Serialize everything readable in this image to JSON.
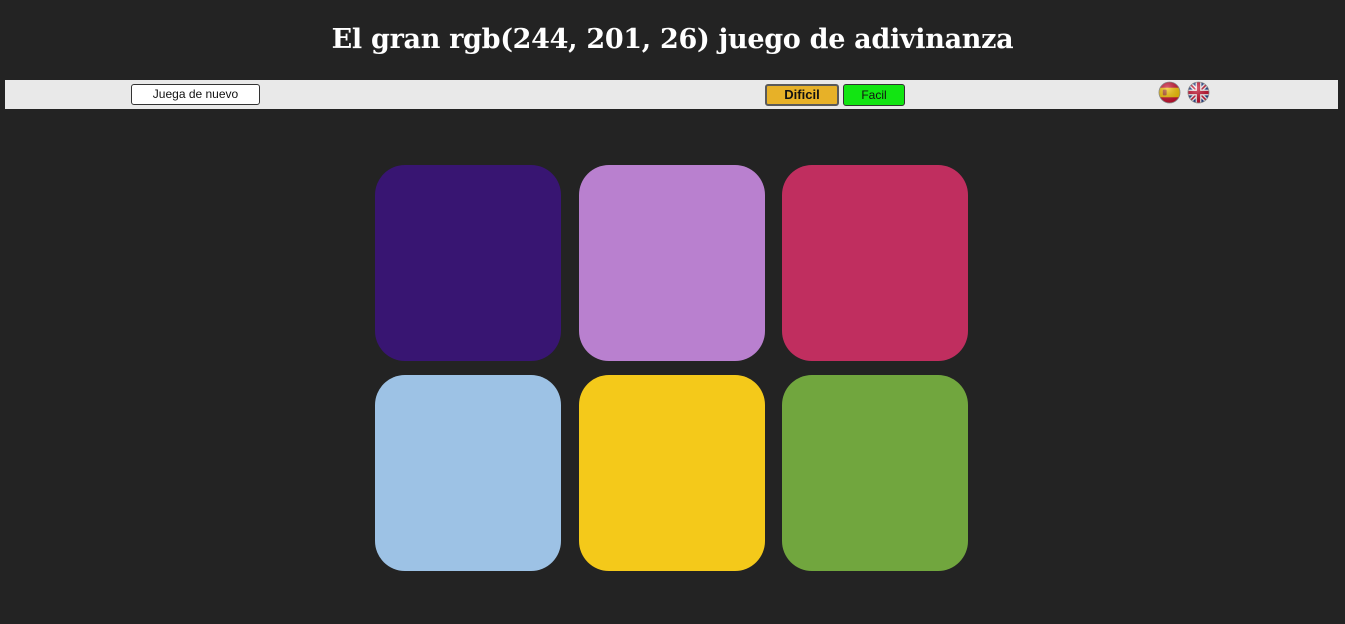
{
  "header": {
    "title": "El gran rgb(244, 201, 26) juego de adivinanza"
  },
  "toolbar": {
    "reset_label": "Juega de nuevo",
    "hard_label": "Dificil",
    "easy_label": "Facil",
    "languages": [
      "spanish-flag-icon",
      "uk-flag-icon"
    ]
  },
  "colors": {
    "background": "#232323",
    "toolbar": "#e9e9e9",
    "hard_button": "#e7b128",
    "easy_button": "#12e512"
  },
  "squares": [
    {
      "color": "#381572"
    },
    {
      "color": "#b980cf"
    },
    {
      "color": "#c02e5f"
    },
    {
      "color": "#9dc2e5"
    },
    {
      "color": "#f4c91a"
    },
    {
      "color": "#71a63e"
    }
  ]
}
